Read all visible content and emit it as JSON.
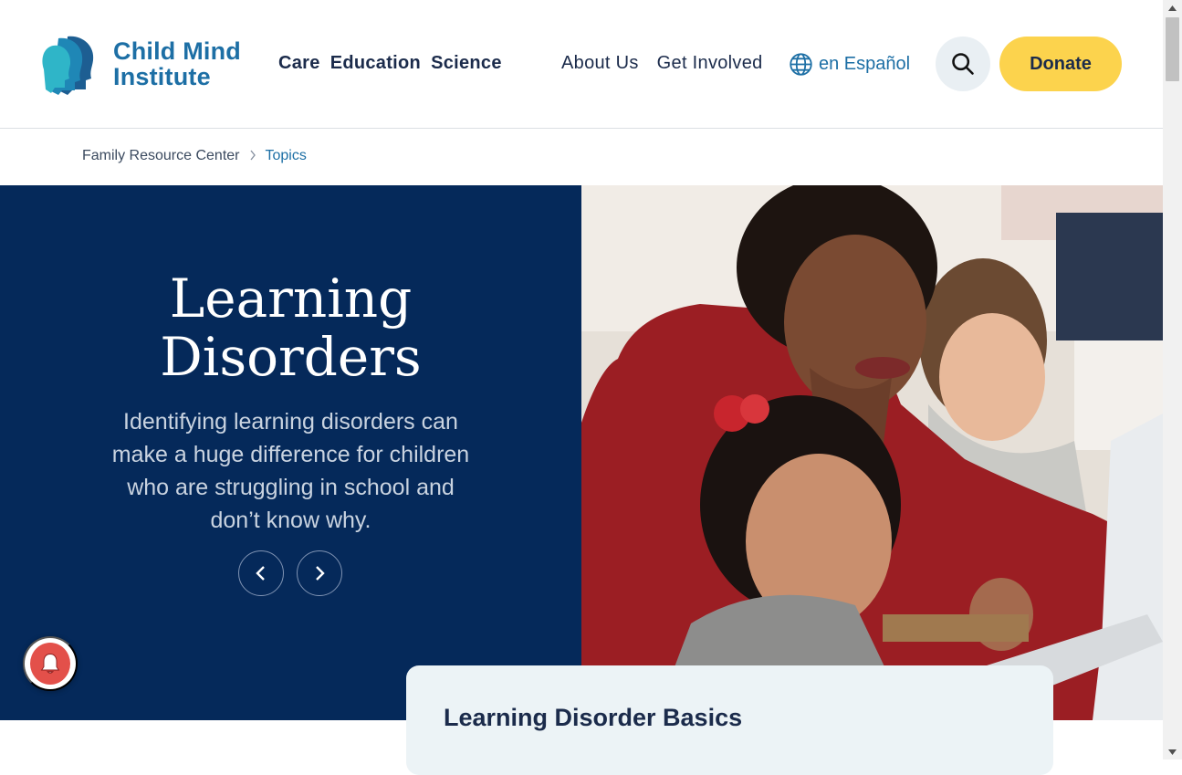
{
  "logo": {
    "line1": "Child Mind",
    "line2": "Institute"
  },
  "primary_nav": [
    "Care",
    "Education",
    "Science"
  ],
  "secondary_nav": [
    "About Us",
    "Get Involved"
  ],
  "language_link": "en Español",
  "donate_label": "Donate",
  "breadcrumb": {
    "item1": "Family Resource Center",
    "item2": "Topics"
  },
  "hero": {
    "title_line1": "Learning",
    "title_line2": "Disorders",
    "description": "Identifying learning disorders can make a huge difference for children who are struggling in school and don’t know why."
  },
  "basics_card": {
    "title": "Learning Disorder Basics"
  },
  "colors": {
    "brand_blue": "#1d6fa5",
    "navy": "#05295a",
    "donate_yellow": "#fcd34d",
    "card_bg": "#ecf3f6",
    "bell_red": "#e3504a"
  },
  "icons": [
    "logo-heads-icon",
    "globe-icon",
    "search-icon",
    "chevron-left-icon",
    "chevron-right-icon",
    "bell-icon"
  ]
}
